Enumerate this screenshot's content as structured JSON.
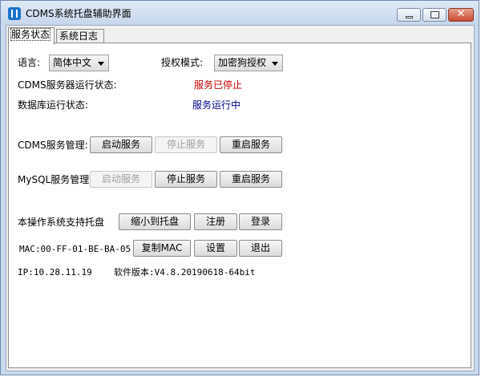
{
  "window": {
    "title": "CDMS系统托盘辅助界面"
  },
  "tabs": [
    {
      "label": "服务状态",
      "active": true
    },
    {
      "label": "系统日志",
      "active": false
    }
  ],
  "settings": {
    "language_label": "语言:",
    "language_value": "简体中文",
    "auth_label": "授权模式:",
    "auth_value": "加密狗授权"
  },
  "status": {
    "cdms_label": "CDMS服务器运行状态:",
    "cdms_value": "服务已停止",
    "db_label": "数据库运行状态:",
    "db_value": "服务运行中"
  },
  "cdms_service": {
    "label": "CDMS服务管理:",
    "start": "启动服务",
    "start_disabled": false,
    "stop": "停止服务",
    "stop_disabled": true,
    "restart": "重启服务"
  },
  "mysql_service": {
    "label": "MySQL服务管理:",
    "start": "启动服务",
    "start_disabled": true,
    "stop": "停止服务",
    "stop_disabled": false,
    "restart": "重启服务"
  },
  "tray": {
    "label": "本操作系统支持托盘",
    "minimize": "缩小到托盘",
    "register": "注册",
    "login": "登录"
  },
  "mac": {
    "text": "MAC:00-FF-01-BE-BA-05",
    "copy": "复制MAC",
    "settings": "设置",
    "exit": "退出"
  },
  "footer": {
    "ip": "IP:10.28.11.19",
    "version": "软件版本:V4.8.20190618-64bit"
  },
  "colors": {
    "stopped": "#cc0000",
    "running": "#00008b",
    "title_bar": "#c9daee",
    "close_button": "#c84a2f"
  }
}
